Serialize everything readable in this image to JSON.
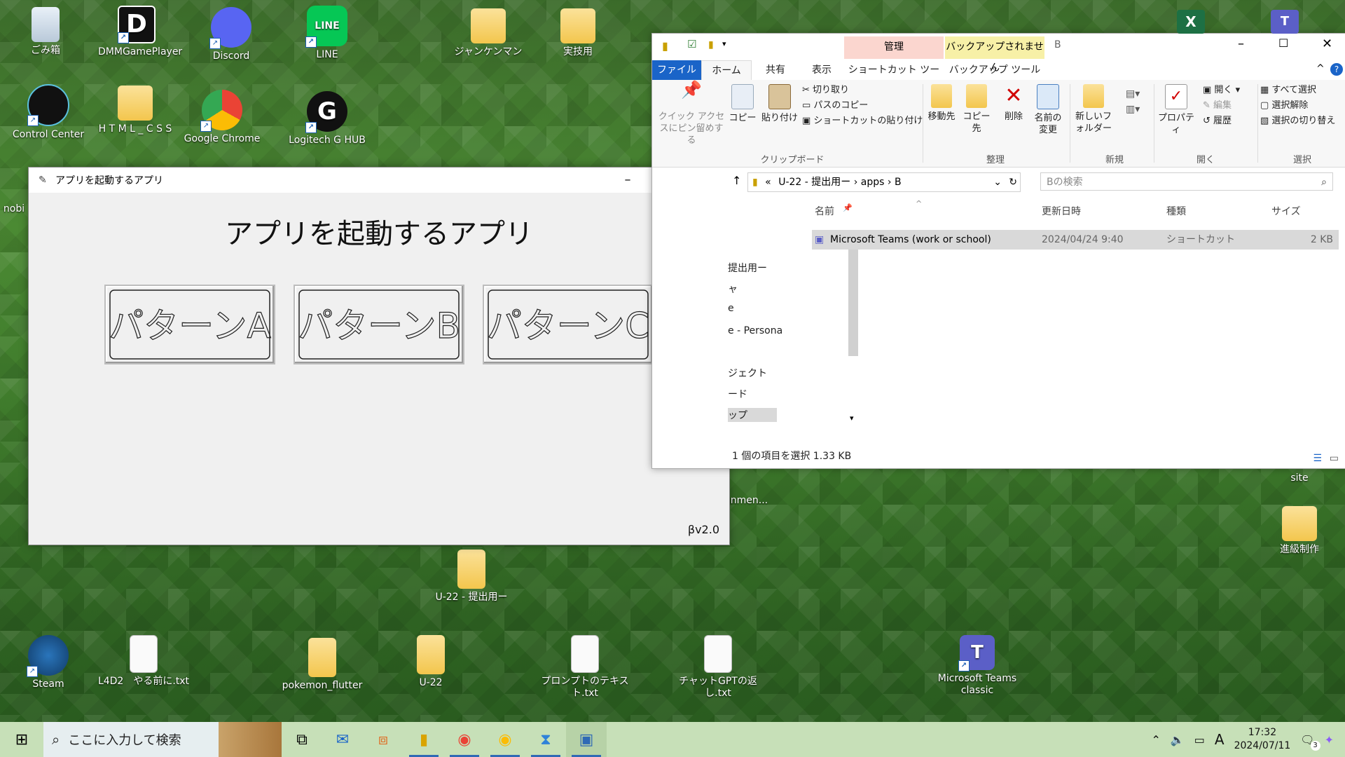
{
  "desktop": {
    "icons": [
      {
        "label": "ごみ箱"
      },
      {
        "label": "DMMGamePlayer"
      },
      {
        "label": "Discord"
      },
      {
        "label": "LINE"
      },
      {
        "label": "ジャンケンマン"
      },
      {
        "label": "実技用"
      },
      {
        "label": "Control Center"
      },
      {
        "label": "H T M L _ C S S"
      },
      {
        "label": "Google Chrome"
      },
      {
        "label": "Logitech G HUB"
      },
      {
        "label": "U-22 - 提出用ー"
      },
      {
        "label": "Steam"
      },
      {
        "label": "L4D2　やる前に.txt"
      },
      {
        "label": "pokemon_flutter"
      },
      {
        "label": "U-22"
      },
      {
        "label": "プロンプトのテキスト.txt"
      },
      {
        "label": "チャットGPTの返し.txt"
      },
      {
        "label": "Microsoft Teams classic"
      },
      {
        "label": "進級制作"
      },
      {
        "label": "site"
      },
      {
        "label": "nobi"
      },
      {
        "label": "gnmen..."
      }
    ]
  },
  "app_window": {
    "title": "アプリを起動するアプリ",
    "heading": "アプリを起動するアプリ",
    "buttons": [
      "パターンA",
      "パターンB",
      "パターンC"
    ],
    "version": "βv2.0"
  },
  "explorer": {
    "context_tabs": [
      "管理",
      "バックアップされません"
    ],
    "window_title": "B",
    "tabs": [
      "ファイル",
      "ホーム",
      "共有",
      "表示",
      "ショートカット ツール",
      "バックアップ ツール"
    ],
    "ribbon": {
      "pin": "クイック アクセスにピン留めする",
      "copy": "コピー",
      "paste": "貼り付け",
      "cut": "切り取り",
      "copy_path": "パスのコピー",
      "paste_shortcut": "ショートカットの貼り付け",
      "group_clipboard": "クリップボード",
      "move_to": "移動先",
      "copy_to": "コピー先",
      "delete": "削除",
      "rename": "名前の変更",
      "group_organize": "整理",
      "new_folder": "新しいフォルダー",
      "group_new": "新規",
      "properties": "プロパティ",
      "open": "開く",
      "edit": "編集",
      "history": "履歴",
      "group_open": "開く",
      "select_all": "すべて選択",
      "select_none": "選択解除",
      "invert": "選択の切り替え",
      "group_select": "選択"
    },
    "breadcrumb": [
      "U-22 - 提出用ー",
      "apps",
      "B"
    ],
    "search_placeholder": "Bの検索",
    "nav_items": [
      "提出用ー",
      "ャ",
      "e",
      "e - Persona",
      "ジェクト",
      "ード",
      "ップ"
    ],
    "columns": [
      "名前",
      "更新日時",
      "種類",
      "サイズ"
    ],
    "rows": [
      {
        "name": "Microsoft Teams (work or school)",
        "date": "2024/04/24 9:40",
        "type": "ショートカット",
        "size": "2 KB"
      }
    ],
    "status": "1 個の項目を選択  1.33 KB"
  },
  "taskbar": {
    "search_placeholder": "ここに入力して検索",
    "time": "17:32",
    "date": "2024/07/11",
    "ime": "A",
    "notification_count": "3"
  }
}
